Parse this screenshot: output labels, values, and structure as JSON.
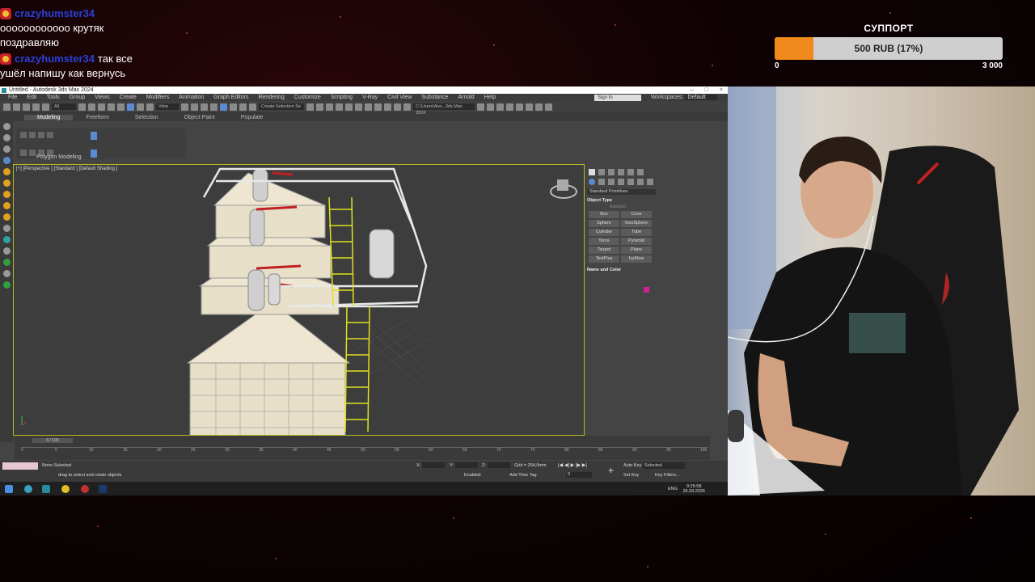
{
  "chat": [
    {
      "user": "crazyhumster34",
      "text": "оооооооооооо крутяк поздравляю"
    },
    {
      "user": "crazyhumster34",
      "text": "так все ушёл напишу как вернусь"
    }
  ],
  "support": {
    "title": "СУППОРТ",
    "amount": "500 RUB (17%)",
    "progress": 0.17,
    "min": "0",
    "max": "3 000",
    "fill_color": "#f08a1c"
  },
  "app": {
    "title": "Untitled - Autodesk 3ds Max 2024",
    "menu": [
      "File",
      "Edit",
      "Tools",
      "Group",
      "Views",
      "Create",
      "Modifiers",
      "Animation",
      "Graph Editors",
      "Rendering",
      "Customize",
      "Scripting",
      "V-Ray",
      "Civil View",
      "Substance",
      "Arnold",
      "Help"
    ],
    "sign_in": "Sign In",
    "workspaces_label": "Workspaces:",
    "workspaces_value": "Default",
    "toolbar": {
      "filter": "All",
      "view": "View",
      "selection_set": "Create Selection Se",
      "path": "C:\\Users\\Ave...3ds Max 2024"
    },
    "ribbon_tabs": [
      "Modeling",
      "Freeform",
      "Selection",
      "Object Paint",
      "Populate"
    ],
    "ribbon_label": "Polygon Modeling",
    "viewport_label": "[+] [Perspective ] [Standard ] [Default Shading ]",
    "command_panel": {
      "dropdown": "Standard Primitives",
      "object_type": "Object Type",
      "autogrid": "AutoGrid",
      "buttons": [
        "Box",
        "Cone",
        "Sphere",
        "GeoSphere",
        "Cylinder",
        "Tube",
        "Torus",
        "Pyramid",
        "Teapot",
        "Plane",
        "TextPlus",
        "IvyFlow"
      ],
      "name_and_color": "Name and Color"
    },
    "timeline": {
      "slider": "0 / 100",
      "ticks": [
        "0",
        "5",
        "10",
        "15",
        "20",
        "25",
        "30",
        "35",
        "40",
        "45",
        "50",
        "55",
        "60",
        "65",
        "70",
        "75",
        "80",
        "85",
        "90",
        "95",
        "100"
      ]
    },
    "status": {
      "selection": "None Selected",
      "prompt": "drag to select and rotate objects",
      "x_label": "X:",
      "y_label": "Y:",
      "z_label": "Z:",
      "grid": "Grid = 254,0mm",
      "enabled": "Enabled:",
      "add_time_tag": "Add Time Tag",
      "frame": "0",
      "auto_key": "Auto Key",
      "set_key": "Set Key",
      "selected": "Selected",
      "key_filters": "Key Filters..."
    },
    "taskbar": {
      "lang": "ENG",
      "time": "9:25:58",
      "date": "26.03.2026"
    }
  },
  "colors": {
    "chat_user": "#2a40d8",
    "viewport_border": "#b8b820",
    "ladder": "#e0e020",
    "accent_blue": "#5a8ad0"
  }
}
